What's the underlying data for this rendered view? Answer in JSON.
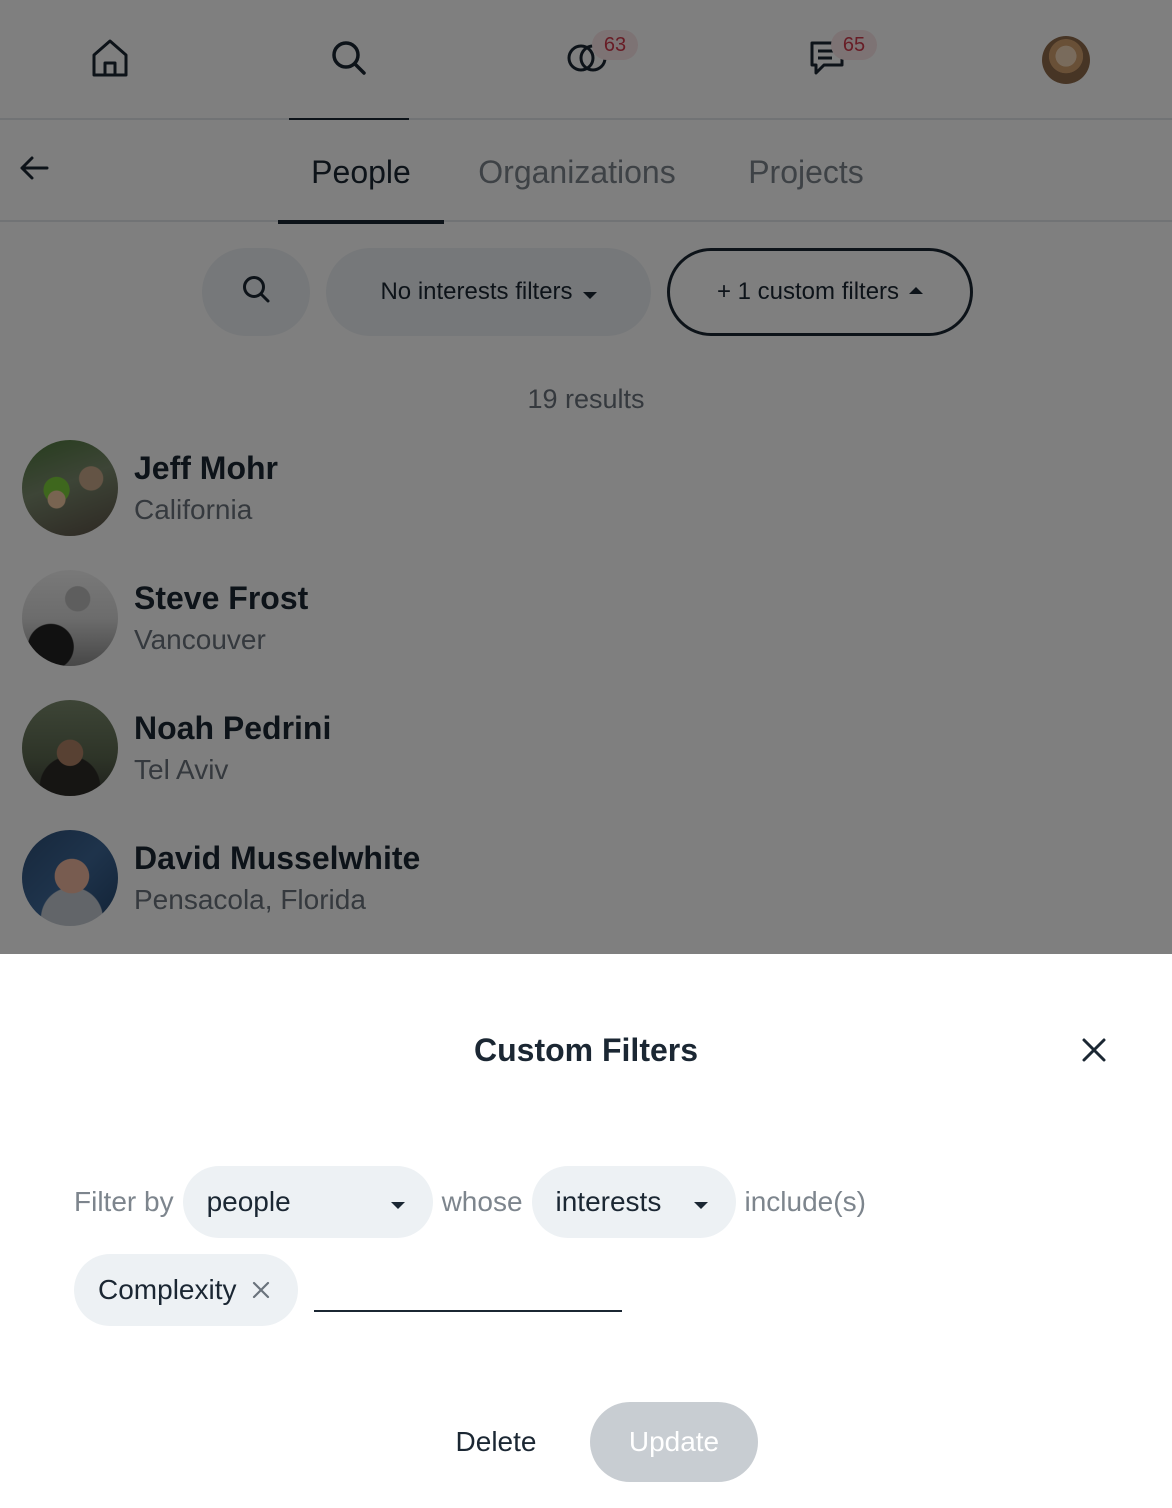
{
  "topnav": {
    "items": [
      {
        "icon": "home-icon"
      },
      {
        "icon": "search-icon",
        "active": true
      },
      {
        "icon": "connections-icon",
        "badge": "63"
      },
      {
        "icon": "messages-icon",
        "badge": "65"
      },
      {
        "icon": "profile-avatar"
      }
    ]
  },
  "tabs": {
    "back_icon": "arrow-left-icon",
    "items": [
      {
        "label": "People",
        "active": true
      },
      {
        "label": "Organizations"
      },
      {
        "label": "Projects"
      }
    ]
  },
  "filters": {
    "search_icon": "search-icon",
    "interests_label": "No interests filters",
    "custom_label": "+ 1 custom filters"
  },
  "results": {
    "count_label": "19 results",
    "people": [
      {
        "name": "Jeff Mohr",
        "location": "California"
      },
      {
        "name": "Steve Frost",
        "location": "Vancouver"
      },
      {
        "name": "Noah Pedrini",
        "location": "Tel Aviv"
      },
      {
        "name": "David Musselwhite",
        "location": "Pensacola, Florida"
      }
    ]
  },
  "sheet": {
    "title": "Custom Filters",
    "filter_by_label": "Filter by",
    "entity_value": "people",
    "whose_label": "whose",
    "field_value": "interests",
    "operator_label": "include(s)",
    "tags": [
      {
        "label": "Complexity"
      }
    ],
    "tag_input_value": "",
    "delete_label": "Delete",
    "update_label": "Update"
  },
  "colors": {
    "text": "#1b2733",
    "muted": "#7d858d",
    "pill_bg": "#edf1f4",
    "badge_bg": "#fbe6e8",
    "badge_text": "#d03a4d",
    "update_disabled": "#c8cdd2"
  }
}
